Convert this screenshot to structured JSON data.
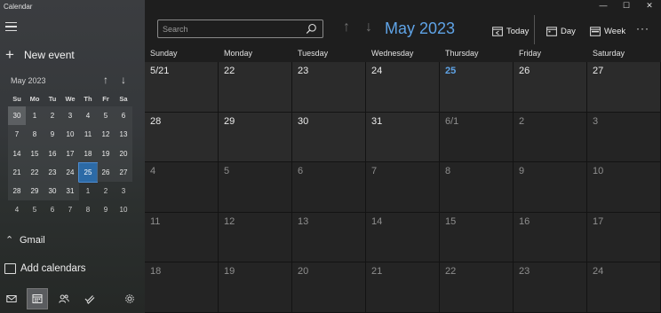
{
  "app": {
    "title": "Calendar"
  },
  "sidebar": {
    "menu_icon": "hamburger-icon",
    "new_event_label": "New event",
    "mini_calendar": {
      "month_label": "May 2023",
      "weekdays": [
        "Su",
        "Mo",
        "Tu",
        "We",
        "Th",
        "Fr",
        "Sa"
      ],
      "days": [
        "30",
        "1",
        "2",
        "3",
        "4",
        "5",
        "6",
        "7",
        "8",
        "9",
        "10",
        "11",
        "12",
        "13",
        "14",
        "15",
        "16",
        "17",
        "18",
        "19",
        "20",
        "21",
        "22",
        "23",
        "24",
        "25",
        "26",
        "27",
        "28",
        "29",
        "30",
        "31",
        "1",
        "2",
        "3",
        "4",
        "5",
        "6",
        "7",
        "8",
        "9",
        "10"
      ],
      "current_month_start_index": 1,
      "current_month_end_index": 31,
      "today_index": 25
    },
    "gmail_label": "Gmail",
    "add_calendars_label": "Add calendars",
    "bottom_icons": [
      "mail-icon",
      "calendar-icon",
      "people-icon",
      "todo-icon",
      "settings-icon"
    ]
  },
  "toolbar": {
    "search_placeholder": "Search",
    "month_title": "May 2023",
    "today_label": "Today",
    "day_label": "Day",
    "week_label": "Week",
    "more_label": "···",
    "accent_color": "#5fa3e6"
  },
  "window_controls": {
    "minimize": "—",
    "maximize": "☐",
    "close": "✕"
  },
  "month_view": {
    "weekday_headers": [
      "Sunday",
      "Monday",
      "Tuesday",
      "Wednesday",
      "Thursday",
      "Friday",
      "Saturday"
    ],
    "today_column": 4,
    "cells": [
      "5/21",
      "22",
      "23",
      "24",
      "25",
      "26",
      "27",
      "28",
      "29",
      "30",
      "31",
      "6/1",
      "2",
      "3",
      "4",
      "5",
      "6",
      "7",
      "8",
      "9",
      "10",
      "11",
      "12",
      "13",
      "14",
      "15",
      "16",
      "17",
      "18",
      "19",
      "20",
      "21",
      "22",
      "23",
      "24"
    ],
    "current_month_cell_count": 11,
    "today_cell_index": 4
  }
}
